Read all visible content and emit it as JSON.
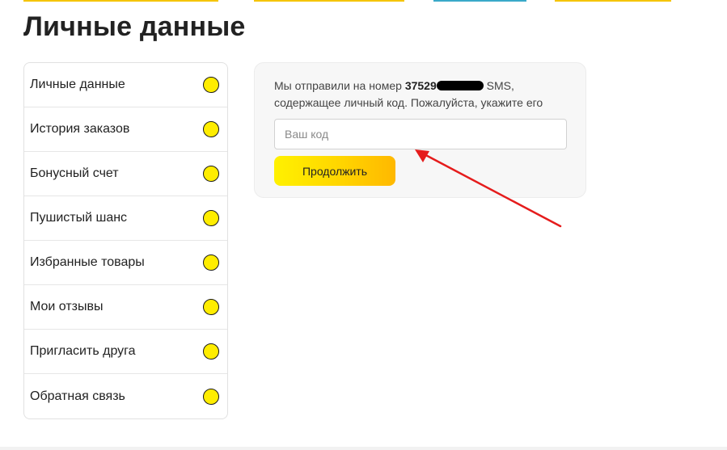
{
  "page": {
    "title": "Личные данные"
  },
  "sidebar": {
    "items": [
      {
        "label": "Личные данные"
      },
      {
        "label": "История заказов"
      },
      {
        "label": "Бонусный счет"
      },
      {
        "label": "Пушистый шанс"
      },
      {
        "label": "Избранные товары"
      },
      {
        "label": "Мои отзывы"
      },
      {
        "label": "Пригласить друга"
      },
      {
        "label": "Обратная связь"
      }
    ]
  },
  "sms_form": {
    "message_prefix": "Мы отправили на номер ",
    "phone_visible": "37529",
    "message_suffix": " SMS, содержащее личный код. Пожалуйста, укажите его",
    "code_input": {
      "value": "",
      "placeholder": "Ваш код"
    },
    "submit_label": "Продолжить"
  },
  "colors": {
    "accent_yellow": "#ffed00",
    "annotation_arrow": "#e51c1c",
    "top_accent_yellow": "#f5c400",
    "top_accent_blue": "#3aa9c9"
  }
}
